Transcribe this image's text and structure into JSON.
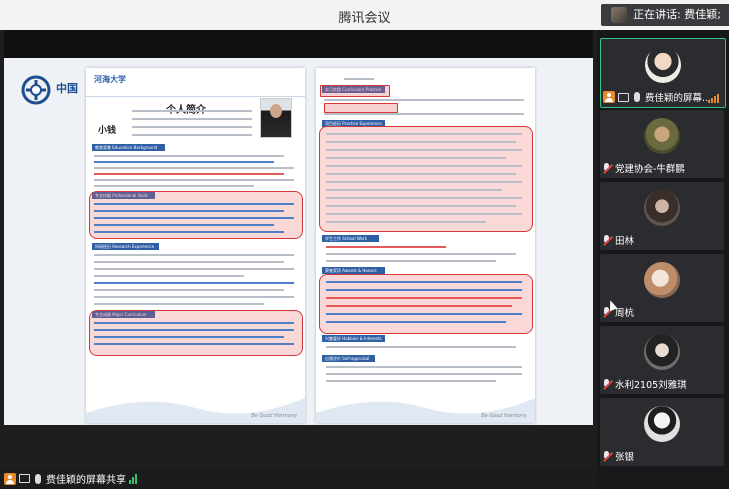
{
  "window": {
    "title": "腾讯会议"
  },
  "speaking": {
    "label": "正在讲话: 费佳颖;"
  },
  "screen_share": {
    "sharer_label": "费佳颖的屏幕共享",
    "slide": {
      "logo_text": "中国",
      "left_page": {
        "university_logo": "河海大学",
        "title": "个人简介",
        "name": "小钱",
        "sections": [
          "教育背景 Education Background",
          "专业技能 Professional Skills",
          "科研经历 Research Experience",
          "专业成绩 Major Curriculum"
        ],
        "watermark": "Be Good Harmony"
      },
      "right_page": {
        "sections": [
          "实习实践 Curriculum Practice",
          "项目经历 Practice Experience",
          "学生工作 School Work",
          "荣誉奖项 Awards & Honors",
          "兴趣爱好 Hobbies & Interests",
          "自我评价 Self-appraisal"
        ],
        "watermark": "Be Good Harmony"
      }
    }
  },
  "participants": [
    {
      "name": "费佳颖的屏幕...",
      "active": true,
      "avatar_color": "#e9e4df",
      "muted": false
    },
    {
      "name": "党建协会-牛群鹏",
      "active": false,
      "avatar_color": "#8a7f52",
      "muted": true
    },
    {
      "name": "田林",
      "active": false,
      "avatar_color": "#7a6a60",
      "muted": true
    },
    {
      "name": "周杭",
      "active": false,
      "avatar_color": "#c9a58c",
      "muted": true
    },
    {
      "name": "水利2105刘雅琪",
      "active": false,
      "avatar_color": "#5a5a5a",
      "muted": true
    },
    {
      "name": "张银",
      "active": false,
      "avatar_color": "#d9d9d9",
      "muted": true
    }
  ],
  "colors": {
    "accent_green": "#2fc38a",
    "highlight_red": "#d33838",
    "section_blue": "#2f5fa5"
  }
}
